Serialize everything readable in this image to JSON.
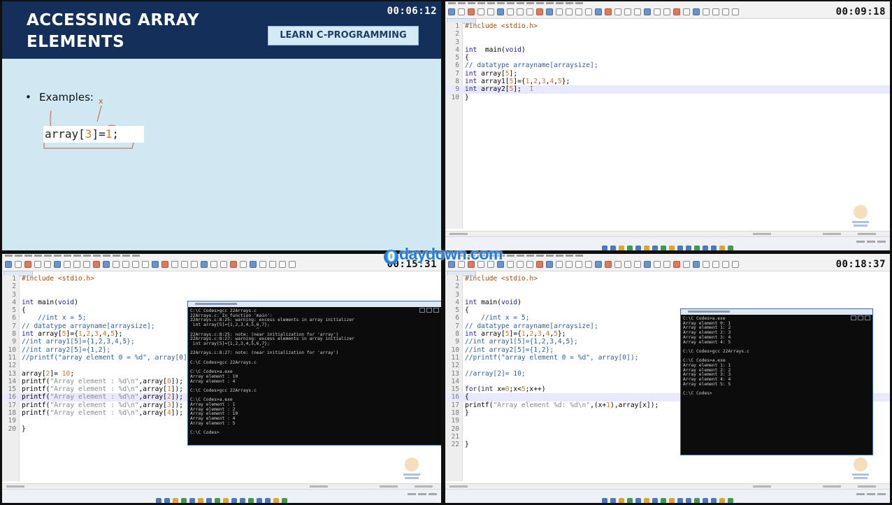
{
  "slide": {
    "title_line1": "ACCESSING ARRAY",
    "title_line2": "ELEMENTS",
    "badge": "LEARN C-PROGRAMMING",
    "timestamp": "00:06:12",
    "bullet_label": "Examples:",
    "example_pre": "array[",
    "example_idx": "3",
    "example_eq": "]=",
    "example_val": "1",
    "example_end": ";",
    "annotation_x": "x"
  },
  "q2": {
    "timestamp": "00:09:18",
    "lines": [
      {
        "n": "1",
        "t": [
          [
            "p",
            "#include <stdio.h>"
          ]
        ]
      },
      {
        "n": "2",
        "t": []
      },
      {
        "n": "3",
        "t": []
      },
      {
        "n": "4",
        "t": [
          [
            "k",
            "int"
          ],
          [
            "",
            "  main("
          ],
          [
            "k",
            "void"
          ],
          [
            "",
            ")"
          ]
        ]
      },
      {
        "n": "5",
        "t": [
          [
            "",
            "{"
          ]
        ]
      },
      {
        "n": "6",
        "t": [
          [
            "c",
            "// datatype arrayname[arraysize];"
          ]
        ]
      },
      {
        "n": "7",
        "t": [
          [
            "k",
            "int"
          ],
          [
            "",
            " array["
          ],
          [
            "n",
            "5"
          ],
          [
            "",
            "];"
          ]
        ]
      },
      {
        "n": "8",
        "t": [
          [
            "k",
            "int"
          ],
          [
            "",
            " array1["
          ],
          [
            "n",
            "5"
          ],
          [
            "",
            "]={"
          ],
          [
            "n",
            "1"
          ],
          [
            "",
            ","
          ],
          [
            "n",
            "2"
          ],
          [
            "",
            ","
          ],
          [
            "n",
            "3"
          ],
          [
            "",
            ","
          ],
          [
            "n",
            "4"
          ],
          [
            "",
            ","
          ],
          [
            "n",
            "5"
          ],
          [
            "",
            "};"
          ]
        ]
      },
      {
        "n": "9",
        "t": [
          [
            "k",
            "int"
          ],
          [
            "",
            " array2["
          ],
          [
            "n",
            "5"
          ],
          [
            "",
            "];  "
          ],
          [
            "s",
            "I"
          ]
        ],
        "hl": true
      },
      {
        "n": "10",
        "t": [
          [
            "",
            "}"
          ]
        ]
      }
    ]
  },
  "q3": {
    "timestamp": "00:15:31",
    "lines": [
      {
        "n": "1",
        "t": [
          [
            "p",
            "#include <stdio.h>"
          ]
        ]
      },
      {
        "n": "2",
        "t": []
      },
      {
        "n": "3",
        "t": []
      },
      {
        "n": "4",
        "t": [
          [
            "k",
            "int"
          ],
          [
            "",
            " main("
          ],
          [
            "k",
            "void"
          ],
          [
            "",
            ")"
          ]
        ]
      },
      {
        "n": "5",
        "t": [
          [
            "",
            "{"
          ]
        ]
      },
      {
        "n": "6",
        "t": [
          [
            "c",
            "    //int x = 5;"
          ]
        ]
      },
      {
        "n": "7",
        "t": [
          [
            "c",
            "// datatype arrayname[arraysize];"
          ]
        ]
      },
      {
        "n": "8",
        "t": [
          [
            "k",
            "int"
          ],
          [
            "",
            " array["
          ],
          [
            "n",
            "5"
          ],
          [
            "",
            "]={"
          ],
          [
            "n",
            "1"
          ],
          [
            "",
            ","
          ],
          [
            "n",
            "2"
          ],
          [
            "",
            ","
          ],
          [
            "n",
            "3"
          ],
          [
            "",
            ","
          ],
          [
            "n",
            "4"
          ],
          [
            "",
            ","
          ],
          [
            "n",
            "5"
          ],
          [
            "",
            "};"
          ]
        ]
      },
      {
        "n": "9",
        "t": [
          [
            "c",
            "//int array1[5]={1,2,3,4,5};"
          ]
        ]
      },
      {
        "n": "10",
        "t": [
          [
            "c",
            "//int array2[5]={1,2};"
          ]
        ]
      },
      {
        "n": "11",
        "t": [
          [
            "c",
            "//printf(\"array element 0 = %d\", array[0]);"
          ]
        ]
      },
      {
        "n": "12",
        "t": []
      },
      {
        "n": "13",
        "t": [
          [
            "",
            "array["
          ],
          [
            "n",
            "2"
          ],
          [
            "",
            "]= "
          ],
          [
            "n",
            "10"
          ],
          [
            "",
            ";"
          ]
        ]
      },
      {
        "n": "14",
        "t": [
          [
            "",
            "printf("
          ],
          [
            "s",
            "\"Array element : %d\\n\""
          ],
          [
            "",
            ",array["
          ],
          [
            "n",
            "0"
          ],
          [
            "",
            "]);"
          ]
        ]
      },
      {
        "n": "15",
        "t": [
          [
            "",
            "printf("
          ],
          [
            "s",
            "\"Array element : %d\\n\""
          ],
          [
            "",
            ",array["
          ],
          [
            "n",
            "1"
          ],
          [
            "",
            "]);"
          ]
        ]
      },
      {
        "n": "16",
        "t": [
          [
            "",
            "printf("
          ],
          [
            "s",
            "\"Array element : %d\\n\""
          ],
          [
            "",
            ",array["
          ],
          [
            "n",
            "2"
          ],
          [
            "",
            "]);"
          ]
        ],
        "hl": true
      },
      {
        "n": "17",
        "t": [
          [
            "",
            "printf("
          ],
          [
            "s",
            "\"Array element : %d\\n\""
          ],
          [
            "",
            ",array["
          ],
          [
            "n",
            "3"
          ],
          [
            "",
            "]);"
          ]
        ]
      },
      {
        "n": "18",
        "t": [
          [
            "",
            "printf("
          ],
          [
            "s",
            "\"Array element : %d\\n\""
          ],
          [
            "",
            ",array["
          ],
          [
            "n",
            "4"
          ],
          [
            "",
            "]);"
          ]
        ]
      },
      {
        "n": "19",
        "t": []
      },
      {
        "n": "20",
        "t": [
          [
            "",
            "}"
          ]
        ]
      }
    ],
    "console": "C:\\C Codes>gcc 22Arrays.c\n22Arrays.c: In function 'main':\n22Arrays.c:8:25: warning: excess elements in array initializer\n int array[5]={1,2,3,4,5,6,7};\n                         ^\n22Arrays.c:8:25: note: (near initialization for 'array')\n22Arrays.c:8:27: warning: excess elements in array initializer\n int array[5]={1,2,3,4,5,6,7};\n                           ^\n22Arrays.c:8:27: note: (near initialization for 'array')\n\nC:\\C Codes>gcc 22Arrays.c\n\nC:\\C Codes>a.exe\nArray element : 10\nArray element : 4\n\nC:\\C Codes>gcc 22Arrays.c\n\nC:\\C Codes>a.exe\nArray element : 1\nArray element : 2\nArray element : 10\nArray element : 4\nArray element : 5\n\nC:\\C Codes>"
  },
  "q4": {
    "timestamp": "00:18:37",
    "lines": [
      {
        "n": "1",
        "t": [
          [
            "p",
            "#include <stdio.h>"
          ]
        ]
      },
      {
        "n": "2",
        "t": []
      },
      {
        "n": "3",
        "t": []
      },
      {
        "n": "4",
        "t": [
          [
            "k",
            "int"
          ],
          [
            "",
            " main("
          ],
          [
            "k",
            "void"
          ],
          [
            "",
            ")"
          ]
        ]
      },
      {
        "n": "5",
        "t": [
          [
            "",
            "{"
          ]
        ]
      },
      {
        "n": "6",
        "t": [
          [
            "c",
            "    //int x = 5;"
          ]
        ]
      },
      {
        "n": "7",
        "t": [
          [
            "c",
            "// datatype arrayname[arraysize];"
          ]
        ]
      },
      {
        "n": "8",
        "t": [
          [
            "k",
            "int"
          ],
          [
            "",
            " array["
          ],
          [
            "n",
            "5"
          ],
          [
            "",
            "]={"
          ],
          [
            "n",
            "1"
          ],
          [
            "",
            ","
          ],
          [
            "n",
            "2"
          ],
          [
            "",
            ","
          ],
          [
            "n",
            "3"
          ],
          [
            "",
            ","
          ],
          [
            "n",
            "4"
          ],
          [
            "",
            ","
          ],
          [
            "n",
            "5"
          ],
          [
            "",
            "};"
          ]
        ]
      },
      {
        "n": "9",
        "t": [
          [
            "c",
            "//int array1[5]={1,2,3,4,5};"
          ]
        ]
      },
      {
        "n": "10",
        "t": [
          [
            "c",
            "//int array2[5]={1,2};"
          ]
        ]
      },
      {
        "n": "11",
        "t": [
          [
            "c",
            "//printf(\"array element 0 = %d\", array[0]);"
          ]
        ]
      },
      {
        "n": "12",
        "t": []
      },
      {
        "n": "13",
        "t": [
          [
            "c",
            "//array[2]= 10;"
          ]
        ]
      },
      {
        "n": "14",
        "t": []
      },
      {
        "n": "15",
        "t": [
          [
            "k",
            "for"
          ],
          [
            "",
            "("
          ],
          [
            "k",
            "int"
          ],
          [
            "",
            " x="
          ],
          [
            "n",
            "0"
          ],
          [
            "",
            ";x<"
          ],
          [
            "n",
            "5"
          ],
          [
            "",
            ";x++)"
          ]
        ]
      },
      {
        "n": "16",
        "t": [
          [
            "",
            "{"
          ]
        ],
        "hl": true
      },
      {
        "n": "17",
        "t": [
          [
            "",
            "printf("
          ],
          [
            "s",
            "\"Array element %d: %d\\n\""
          ],
          [
            "",
            ",(x+"
          ],
          [
            "n",
            "1"
          ],
          [
            "",
            "),array[x]);"
          ]
        ]
      },
      {
        "n": "18",
        "t": [
          [
            "",
            "}"
          ]
        ]
      },
      {
        "n": "19",
        "t": []
      },
      {
        "n": "20",
        "t": []
      },
      {
        "n": "21",
        "t": []
      },
      {
        "n": "22",
        "t": [
          [
            "",
            "}"
          ]
        ]
      }
    ],
    "console": "C:\\C Codes>a.exe\nArray element 0: 1\nArray element 1: 2\nArray element 2: 3\nArray element 3: 4\nArray element 4: 5\n\nC:\\C Codes>gcc 22Arrays.c\n\nC:\\C Codes>a.exe\nArray element 1: 1\nArray element 2: 2\nArray element 3: 3\nArray element 4: 4\nArray element 5: 5\n\nC:\\C Codes>"
  },
  "watermark": {
    "o": "0",
    "text": "daydown.com"
  },
  "colors": {
    "slide_header": "#14305a",
    "slide_bg": "#cfe8f1",
    "keyword": "#1a1aa6",
    "number": "#e07020",
    "comment": "#2f5f9f"
  }
}
